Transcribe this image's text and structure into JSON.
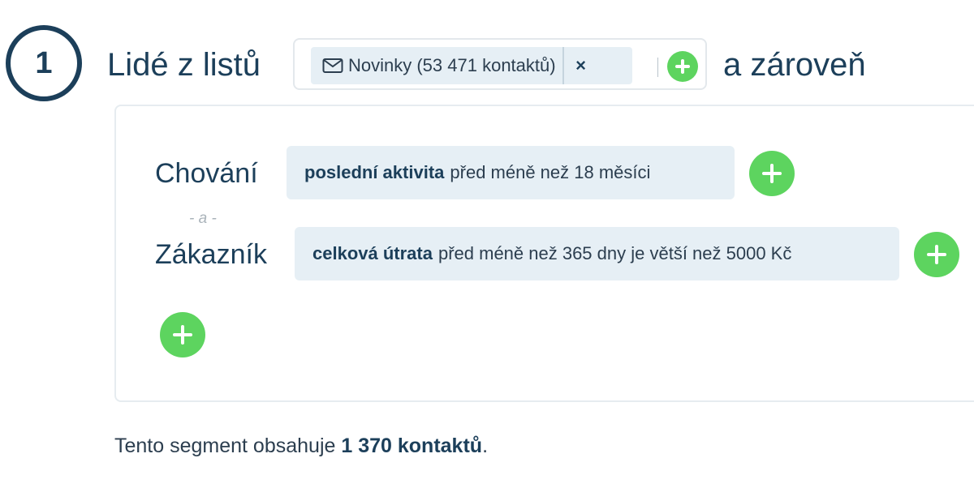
{
  "step": {
    "number": "1"
  },
  "heading": {
    "prefix": "Lidé z listů",
    "suffix": "a zároveň"
  },
  "list_selector": {
    "tags": [
      {
        "icon": "mail-icon",
        "label": "Novinky (53 471 kontaktů)",
        "remove_label": "×"
      }
    ],
    "add_icon": "plus-icon"
  },
  "conditions": {
    "rows": [
      {
        "category": "Chování",
        "field": "poslední aktivita",
        "rule": "před méně než 18 měsíci"
      },
      {
        "category": "Zákazník",
        "field": "celková útrata",
        "rule": "před méně než 365 dny je větší než 5000 Kč"
      }
    ],
    "separator": "- a -"
  },
  "summary": {
    "prefix": "Tento segment obsahuje",
    "count": "1 370 kontaktů",
    "suffix": "."
  },
  "colors": {
    "primary": "#1c3f5a",
    "add_button": "#5dd45f",
    "pill_bg": "#e6eff5",
    "border": "#e3e8ec"
  }
}
